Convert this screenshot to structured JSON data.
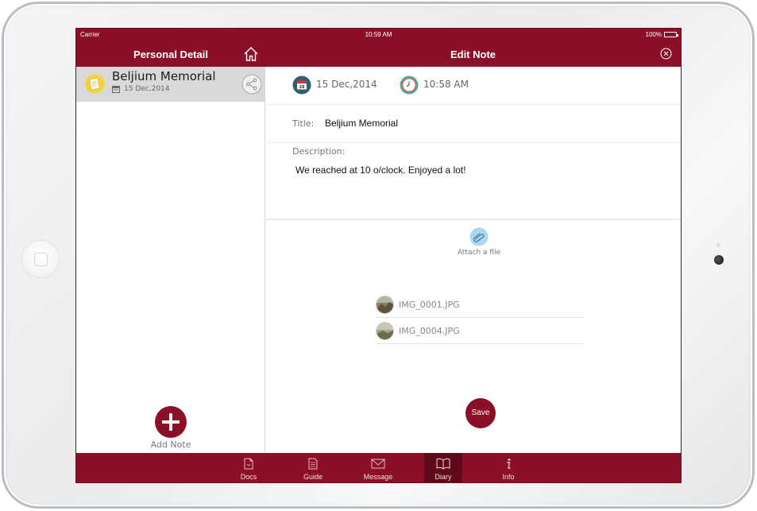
{
  "status_bar": {
    "carrier": "Carrier",
    "time": "10:59 AM",
    "battery": "100%"
  },
  "nav": {
    "left_title": "Personal Detail",
    "center_title": "Edit Note",
    "home_icon": "home-icon",
    "close_icon": "close-icon"
  },
  "notes": [
    {
      "title": "Beljium Memorial",
      "date": "15 Dec,2014"
    }
  ],
  "add_note": {
    "label": "Add Note"
  },
  "editor": {
    "date": "15 Dec,2014",
    "time": "10:58 AM",
    "title_label": "Title:",
    "title_value": "Beljium Memorial",
    "description_label": "Description:",
    "description_value": "We reached at 10 o/clock. Enjoyed a lot!",
    "attach_label": "Attach a file",
    "files": [
      {
        "name": "IMG_0001.JPG"
      },
      {
        "name": "IMG_0004.JPG"
      }
    ],
    "save_label": "Save"
  },
  "tabs": [
    {
      "label": "Docs",
      "icon": "document-icon"
    },
    {
      "label": "Guide",
      "icon": "guide-icon"
    },
    {
      "label": "Message",
      "icon": "envelope-icon"
    },
    {
      "label": "Diary",
      "icon": "book-icon",
      "active": true
    },
    {
      "label": "Info",
      "icon": "info-icon"
    }
  ],
  "colors": {
    "primary": "#8b0f26",
    "active_tab": "#5e0a1a",
    "selected_row": "#d9d9d9"
  }
}
